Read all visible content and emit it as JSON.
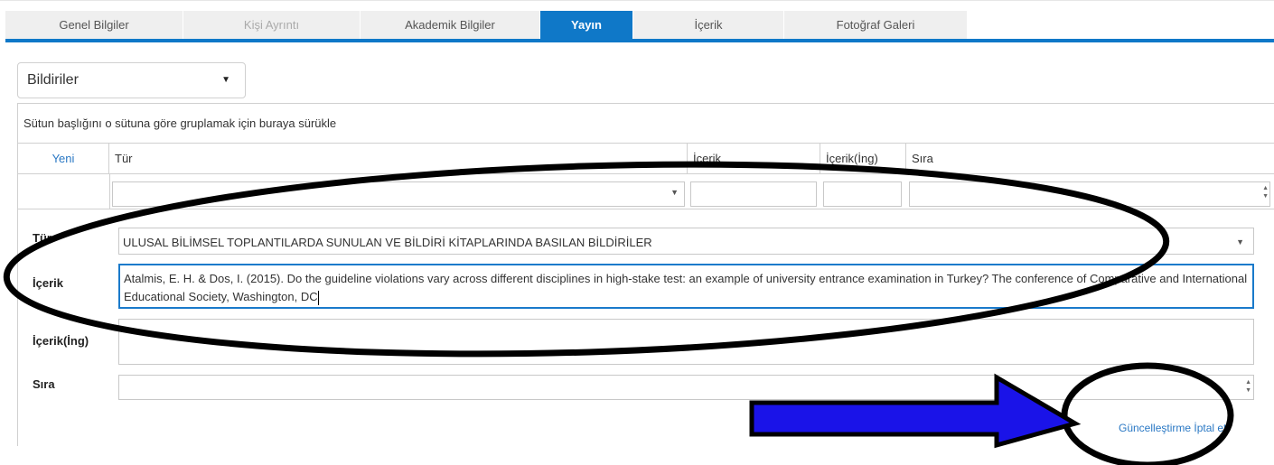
{
  "tabs": [
    {
      "label": "Genel Bilgiler"
    },
    {
      "label": "Kişi Ayrıntı"
    },
    {
      "label": "Akademik Bilgiler"
    },
    {
      "label": "Yayın"
    },
    {
      "label": "İçerik"
    },
    {
      "label": "Fotoğraf Galeri"
    }
  ],
  "category_select": {
    "value": "Bildiriler"
  },
  "grid": {
    "grouping_hint": "Sütun başlığını o sütuna göre gruplamak için buraya sürükle",
    "new_label": "Yeni",
    "columns": [
      "Tür",
      "İçerik",
      "İçerik(İng)",
      "Sıra"
    ]
  },
  "form": {
    "tur_label": "Tür",
    "tur_value": "ULUSAL BİLİMSEL TOPLANTILARDA SUNULAN VE BİLDİRİ KİTAPLARINDA BASILAN BİLDİRİLER",
    "icerik_label": "İçerik",
    "icerik_value": "Atalmis, E. H. & Dos, I. (2015). Do the guideline violations vary across different disciplines in high-stake test: an example of university entrance examination in Turkey? The conference of Comparative and International Educational Society, Washington, DC",
    "icerik_ing_label": "İçerik(İng)",
    "icerik_ing_value": "",
    "sira_label": "Sıra",
    "sira_value": ""
  },
  "actions": {
    "update": "Güncelleştirme",
    "cancel": "İptal et"
  },
  "colors": {
    "accent": "#0f78c8",
    "link": "#2a78c4",
    "arrow": "#1a13e8"
  }
}
